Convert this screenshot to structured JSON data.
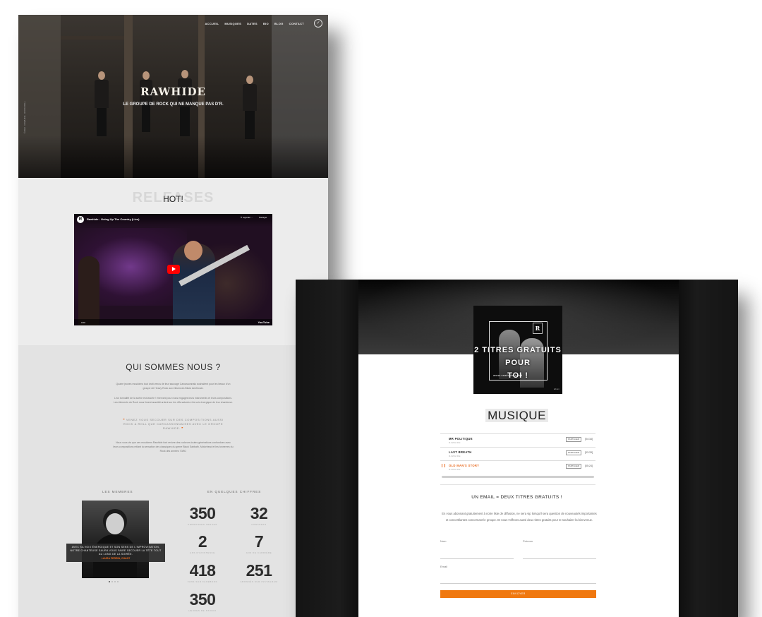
{
  "home": {
    "nav": [
      "ACCUEIL",
      "MUSIQUES",
      "DATES",
      "BIO",
      "BLOG",
      "CONTACT"
    ],
    "brand": "RAWHIDE",
    "tagline": "LE GROUPE DE ROCK QUI NE MANQUE PAS D'R.",
    "side_credit": "©2022 · RAWHIDE · ROCK ROLL",
    "releases_bg": "RELEASES",
    "releases_title": "HOT!",
    "video": {
      "channel_icon": "R",
      "title": "Rawhide - Going Up The Country (Live)",
      "action_later": "À regarder ...",
      "action_share": "Partager",
      "time": "0:00",
      "brand": "YouTube"
    },
    "about": {
      "title": "QUI SOMMES NOUS ?",
      "p1": "Quatre jeunes musiciens tout droit venus de leur sauvage Carcassonnais souhaitent pour les beaux d'un groupe de Heavy Rock aux influences Blues Américain.",
      "p2": "Leur tonnalité de la scène est lancée ! énervant pour nous engagés leurs instruments et leurs compositions. Les éléments du Rock nous liment aussitôt ardent sur les riffs saturés et la voix énergique de leur chanteuse.",
      "quote": "VENEZ VOUS SECOUER SUR DES COMPOSITIONS AUSSI ROCK & ROLL QUE CARCASSONNAISES AVEC LE GROUPE RAWHIDE.",
      "p3": "Nous vous via que ces musiciens Rawhide font revivre des rockeurs toutes générations confondues avec leurs compositions reliant la sensation des classiques du genre Black Sabbath, Motorhead et les tonnerres du Rock des années 70/80."
    },
    "members": {
      "label": "LES MEMBRES",
      "quote": "AVEC SA VOIX ÉNERGIQUE ET SON SENS DE L'IMPROVISATION, NOTRE CHANTEUSE SAURA VOUS FAIRE SECOUER LA TÊTE TOUT AU LONG DE LA SOIRÉE.",
      "name": "LAURA PERRIN, CHANT"
    },
    "figures": {
      "label": "EN QUELQUES CHIFFRES",
      "items": [
        {
          "value": "350",
          "label": "PERSONNES VENUES"
        },
        {
          "value": "32",
          "label": "CONCERTS"
        },
        {
          "value": "2",
          "label": "ANS D'EXISTENCE"
        },
        {
          "value": "7",
          "label": "ANS DE CARRIÈRE"
        },
        {
          "value": "418",
          "label": "FANS SUR FACEBOOK"
        },
        {
          "value": "251",
          "label": "ABONNÉS SUR INSTAGRAM"
        },
        {
          "value": "350",
          "label": "HEURES DE STUDIO"
        }
      ]
    }
  },
  "music": {
    "cover": {
      "title_line1": "2 TITRES GRATUITS POUR",
      "title_line2": "TOI !",
      "url": "www.rawhide.band",
      "logo": "R",
      "badge": "album"
    },
    "title": "MUSIQUE",
    "tracks": [
      {
        "name": "MR POLITIQUE",
        "artist": "RAWHIDE",
        "action": "PARTAGER",
        "duration": "[04:16]",
        "active": false
      },
      {
        "name": "LAST BREATH",
        "artist": "RAWHIDE",
        "action": "PARTAGER",
        "duration": "[03:33]",
        "active": false
      },
      {
        "name": "OLD MAN'S STORY",
        "artist": "RAWHIDE",
        "action": "PARTAGER",
        "duration": "[05:24]",
        "active": true
      }
    ],
    "newsletter": {
      "title": "UN EMAIL = DEUX TITRES GRATUITS !",
      "description": "En vous abonnant gratuitement à notre liste de diffusion, ne sera vip lorsqu'il sera question de nouveautés importantes et concertilantes concernant le groupe. Et nous t'offrons aussi deux titres gratuits pour te souhaiter la bienvenue.",
      "field_nom": "Nom",
      "field_prenom": "Prénom",
      "field_email": "Email",
      "submit": "ENVOYER"
    }
  }
}
